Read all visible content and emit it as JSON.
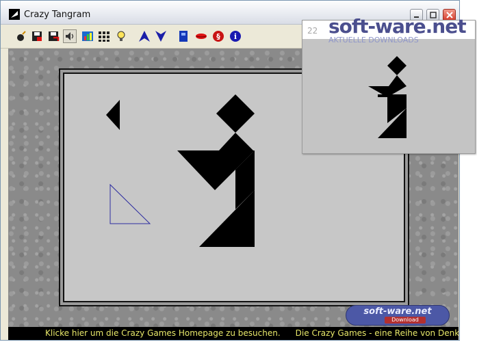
{
  "window": {
    "title": "Crazy Tangram"
  },
  "toolbar": {
    "buttons": [
      {
        "name": "new-game-button",
        "icon": "wand-icon"
      },
      {
        "name": "save-button",
        "icon": "disk-red-icon"
      },
      {
        "name": "save-as-button",
        "icon": "disk-red-arrow-icon"
      },
      {
        "name": "sound-button",
        "icon": "speaker-icon"
      },
      {
        "name": "statistics-button",
        "icon": "chart-icon"
      },
      {
        "name": "grid-button",
        "icon": "grid-icon"
      },
      {
        "name": "hint-button",
        "icon": "lightbulb-icon"
      },
      {
        "name": "previous-button",
        "icon": "arrow-up-icon"
      },
      {
        "name": "next-button",
        "icon": "arrow-down-icon"
      },
      {
        "name": "exit-button",
        "icon": "door-icon"
      },
      {
        "name": "lips-button",
        "icon": "lips-icon"
      },
      {
        "name": "paragraph-button",
        "icon": "paragraph-icon"
      },
      {
        "name": "info-button",
        "icon": "info-icon"
      }
    ]
  },
  "statusbar": {
    "link_text": "Klicke hier um die Crazy Games Homepage zu besuchen.",
    "ticker_text": "Die Crazy Games - eine Reihe von Denk"
  },
  "overlay": {
    "puzzle_number": "22",
    "brand": "soft-ware.net",
    "brand_sub": "AKTUELLE DOWNLOADS"
  },
  "watermark": {
    "text": "soft-ware.net",
    "sub": "Download"
  },
  "colors": {
    "piece": "#000000",
    "outline": "#2c2ca0",
    "board": "#c7c7c7",
    "status_text": "#e8e86a",
    "brand": "#4b4f8e"
  }
}
